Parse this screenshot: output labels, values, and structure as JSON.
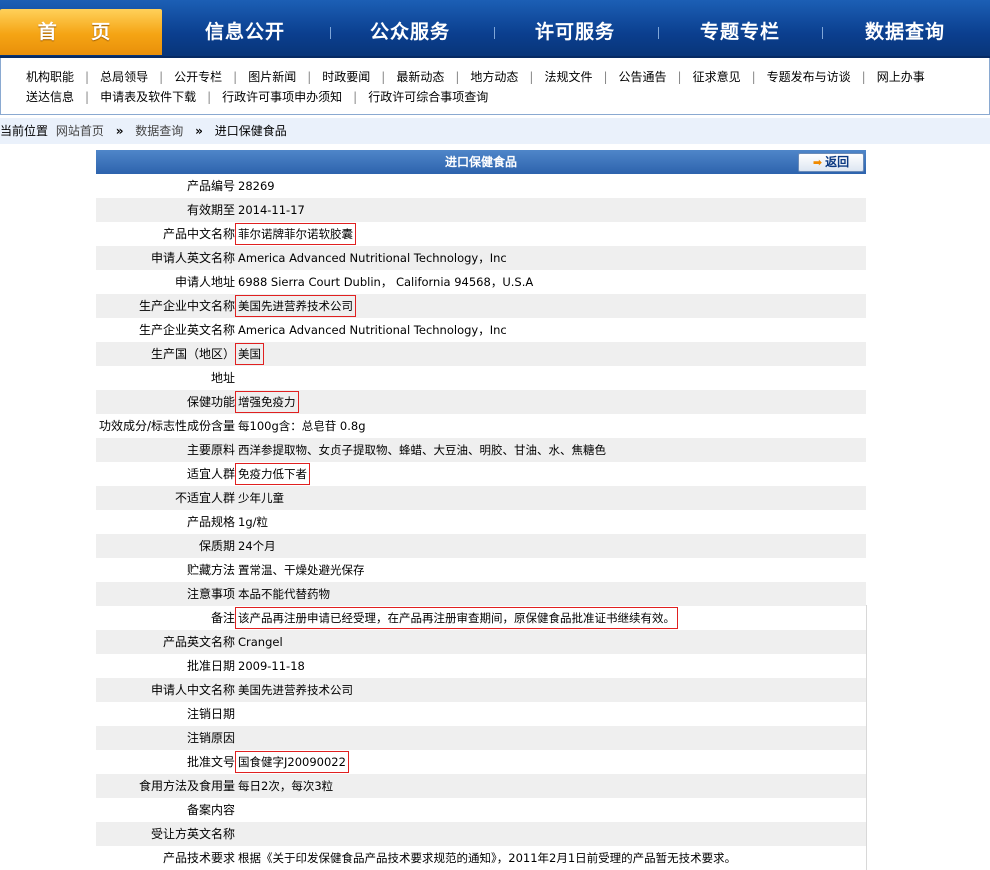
{
  "nav": {
    "items": [
      "首 页",
      "信息公开",
      "公众服务",
      "许可服务",
      "专题专栏",
      "数据查询"
    ]
  },
  "subnav": {
    "row1": [
      "机构职能",
      "总局领导",
      "公开专栏",
      "图片新闻",
      "时政要闻",
      "最新动态",
      "地方动态",
      "法规文件",
      "公告通告",
      "征求意见",
      "专题发布与访谈",
      "网上办事"
    ],
    "row2": [
      "送达信息",
      "申请表及软件下载",
      "行政许可事项申办须知",
      "行政许可综合事项查询"
    ]
  },
  "breadcrumb": {
    "label": "当前位置",
    "items": [
      "网站首页",
      "数据查询",
      "进口保健食品"
    ]
  },
  "detail": {
    "title": "进口保健食品",
    "back_label": "返回",
    "rows": [
      {
        "label": "产品编号",
        "value": "28269",
        "boxed": false
      },
      {
        "label": "有效期至",
        "value": "2014-11-17",
        "boxed": false
      },
      {
        "label": "产品中文名称",
        "value": "菲尔诺牌菲尔诺软胶囊",
        "boxed": true
      },
      {
        "label": "申请人英文名称",
        "value": "America Advanced Nutritional Technology，Inc",
        "boxed": false
      },
      {
        "label": "申请人地址",
        "value": "6988 Sierra Court Dublin， California 94568，U.S.A",
        "boxed": false
      },
      {
        "label": "生产企业中文名称",
        "value": "美国先进营养技术公司",
        "boxed": true
      },
      {
        "label": "生产企业英文名称",
        "value": "America Advanced Nutritional Technology，Inc",
        "boxed": false
      },
      {
        "label": "生产国（地区）",
        "value": "美国",
        "boxed": true
      },
      {
        "label": "地址",
        "value": "",
        "boxed": false
      },
      {
        "label": "保健功能",
        "value": "增强免疫力",
        "boxed": true
      },
      {
        "label": "功效成分/标志性成份含量",
        "value": "每100g含：总皂苷 0.8g",
        "boxed": false
      },
      {
        "label": "主要原料",
        "value": "西洋参提取物、女贞子提取物、蜂蜡、大豆油、明胶、甘油、水、焦糖色",
        "boxed": false
      },
      {
        "label": "适宜人群",
        "value": "免疫力低下者",
        "boxed": true
      },
      {
        "label": "不适宜人群",
        "value": "少年儿童",
        "boxed": false
      },
      {
        "label": "产品规格",
        "value": "1g/粒",
        "boxed": false
      },
      {
        "label": "保质期",
        "value": "24个月",
        "boxed": false
      },
      {
        "label": "贮藏方法",
        "value": "置常温、干燥处避光保存",
        "boxed": false
      },
      {
        "label": "注意事项",
        "value": "本品不能代替药物",
        "boxed": false
      },
      {
        "label": "备注",
        "value": "该产品再注册申请已经受理，在产品再注册审查期间，原保健食品批准证书继续有效。",
        "boxed": true
      },
      {
        "label": "产品英文名称",
        "value": "Crangel",
        "boxed": false
      },
      {
        "label": "批准日期",
        "value": "2009-11-18",
        "boxed": false
      },
      {
        "label": "申请人中文名称",
        "value": "美国先进营养技术公司",
        "boxed": false
      },
      {
        "label": "注销日期",
        "value": "",
        "boxed": false
      },
      {
        "label": "注销原因",
        "value": "",
        "boxed": false
      },
      {
        "label": "批准文号",
        "value": "国食健字J20090022",
        "boxed": true
      },
      {
        "label": "食用方法及食用量",
        "value": "每日2次，每次3粒",
        "boxed": false
      },
      {
        "label": "备案内容",
        "value": "",
        "boxed": false
      },
      {
        "label": "受让方英文名称",
        "value": "",
        "boxed": false
      },
      {
        "label": "产品技术要求",
        "value": "根据《关于印发保健食品产品技术要求规范的通知》，2011年2月1日前受理的产品暂无技术要求。",
        "boxed": false
      }
    ]
  }
}
